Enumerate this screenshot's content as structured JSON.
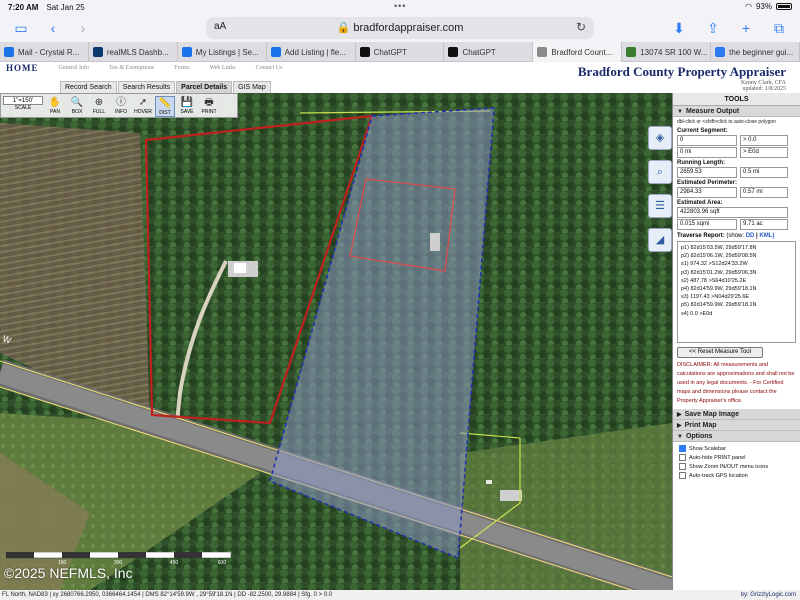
{
  "status": {
    "time": "7:20 AM",
    "date": "Sat Jan 25",
    "battery": "93%"
  },
  "browser": {
    "aa": "aA",
    "url": "bradfordappraiser.com",
    "tabs": [
      {
        "label": "Mail - Crystal R...",
        "color": "#1a73e8"
      },
      {
        "label": "realMLS Dashb...",
        "color": "#0b3a6e"
      },
      {
        "label": "My Listings | Se...",
        "color": "#1a73e8"
      },
      {
        "label": "Add Listing | fle...",
        "color": "#1a73e8"
      },
      {
        "label": "ChatGPT",
        "color": "#111111"
      },
      {
        "label": "ChatGPT",
        "color": "#111111"
      },
      {
        "label": "Bradford Count...",
        "color": "#8a8a8a"
      },
      {
        "label": "13074 SR 100 W...",
        "color": "#3a7d2c"
      },
      {
        "label": "the beginner gui...",
        "color": "#2d7cf6"
      }
    ]
  },
  "site": {
    "nav": [
      "HOME",
      "General Info",
      "Tax & Exemptions",
      "Forms",
      "Web Links",
      "Contact Us"
    ],
    "title": "Bradford County Property Appraiser",
    "appraiser": "Kenny Clark, CFA",
    "updated": "updated: 1/8/2025",
    "subtabs": [
      "Record Search",
      "Search Results",
      "Parcel Details",
      "GIS Map"
    ]
  },
  "maptools": {
    "scale_value": "1\"=150'",
    "scale_label": "SCALE",
    "tools": [
      "PAN",
      "BOX",
      "FULL",
      "INFO",
      "HOVER",
      "DIST",
      "SAVE",
      "PRINT"
    ]
  },
  "map": {
    "road_label": "W",
    "copyright": "©2025 NEFMLS, Inc",
    "scale_ticks": [
      "150",
      "300",
      "450",
      "600"
    ],
    "status": "FL North, NAD83 | xy 2680766.2950, 0366464.1454 | DMS 82°14'59.9W , 29°59'18.1N | DD -82.2500, 29.9884 | Sfg. 0 > 0.0",
    "credit": "by: GrizzlyLogic.com"
  },
  "panel": {
    "title": "TOOLS",
    "measure_title": "Measure Output",
    "hint": "dbl-click or <shift>click to auto-close polygon",
    "current_segment_label": "Current Segment:",
    "current_segment": [
      "0",
      "> 0.0",
      "0 mi",
      "> E0d"
    ],
    "running_length_label": "Running Length:",
    "running_length": [
      "2659.53",
      "0.5 mi"
    ],
    "perimeter_label": "Estimated Perimeter:",
    "perimeter": [
      "2984.33",
      "0.57 mi"
    ],
    "area_label": "Estimated Area:",
    "area_sqft": "422803.96 sqft",
    "area": [
      "0.015 sqmi",
      "9.71 ac"
    ],
    "traverse_label": "Traverse Report:",
    "traverse_show": "(show:",
    "traverse_dd": "DD",
    "traverse_kml": "KML)",
    "traverse": [
      "p1) 82d15'03.5W, 29d59'17.8N",
      "p2) 82d15'06.1W, 29d59'08.5N",
      "s1) 974.32 >S12d24'33.2W",
      "p3) 82d15'01.2W, 29d59'06.3N",
      "s2) 487.78 >S64d10'25.2E",
      "p4) 82d14'59.9W, 29d59'18.1N",
      "s3) 1197.43 >N04d29'25.6E",
      "p5) 82d14'59.9W, 29d59'18.1N",
      "s4) 0.0 >E0d"
    ],
    "reset": "<< Reset Measure Tool",
    "disclaimer": "DISCLAIMER: All measurements and calculations are approximations and shall not be used in any legal documents. - For Certified maps and dimensions please contact the Property Appraiser's office.",
    "save_map": "Save Map Image",
    "print_map": "Print Map",
    "options_title": "Options",
    "options": [
      {
        "label": "Show Scalebar",
        "checked": true
      },
      {
        "label": "Auto-hide PRINT panel",
        "checked": false
      },
      {
        "label": "Show Zoom IN/OUT menu icons",
        "checked": false
      },
      {
        "label": "Auto-track GPS location",
        "checked": false
      }
    ]
  }
}
